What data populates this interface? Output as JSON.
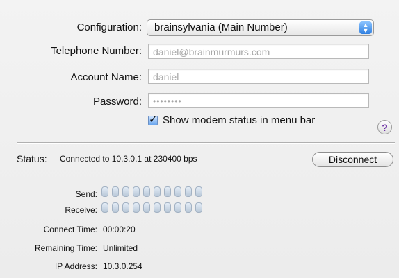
{
  "form": {
    "configuration_label": "Configuration:",
    "configuration_value": "brainsylvania (Main Number)",
    "telephone_label": "Telephone Number:",
    "telephone_value": "daniel@brainmurmurs.com",
    "account_label": "Account Name:",
    "account_value": "daniel",
    "password_label": "Password:",
    "password_value": "••••••••",
    "show_modem_status_label": "Show modem status in menu bar",
    "show_modem_status_checked": true,
    "help_label": "?"
  },
  "status": {
    "label": "Status:",
    "value": "Connected to 10.3.0.1 at 230400 bps",
    "disconnect_label": "Disconnect",
    "send_label": "Send:",
    "receive_label": "Receive:",
    "send_leds": 10,
    "receive_leds": 10,
    "connect_time_label": "Connect Time:",
    "connect_time_value": "00:00:20",
    "remaining_time_label": "Remaining Time:",
    "remaining_time_value": "Unlimited",
    "ip_address_label": "IP Address:",
    "ip_address_value": "10.3.0.254"
  },
  "colors": {
    "accent": "#2f7fe0",
    "help_glyph": "#6b2fa3"
  }
}
